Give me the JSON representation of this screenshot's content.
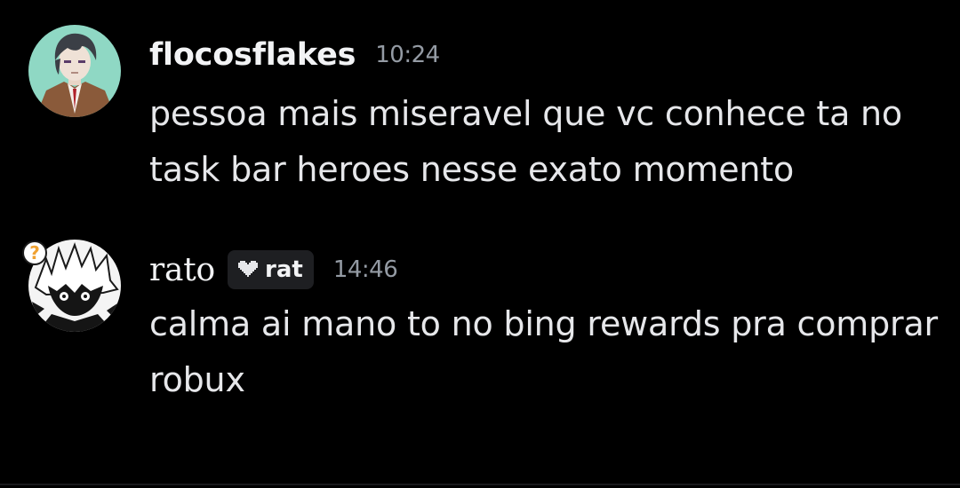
{
  "messages": [
    {
      "username": "flocosflakes",
      "timestamp": "10:24",
      "text": "pessoa mais miseravel que vc conhece ta no task bar heroes nesse exato momento",
      "avatar": "anime-character-avatar"
    },
    {
      "username": "rato",
      "tag_icon": "pixel-heart-icon",
      "tag": "rat",
      "timestamp": "14:46",
      "text": "calma ai mano to no bing rewards pra comprar robux",
      "avatar": "manga-character-avatar",
      "avatar_decoration": "?"
    }
  ],
  "colors": {
    "background": "#000000",
    "username": "#f2f3f5",
    "timestamp": "#949ba4",
    "text": "#e6e7ea",
    "tag_bg": "#1e1f22",
    "question_badge": "#f0a232"
  }
}
